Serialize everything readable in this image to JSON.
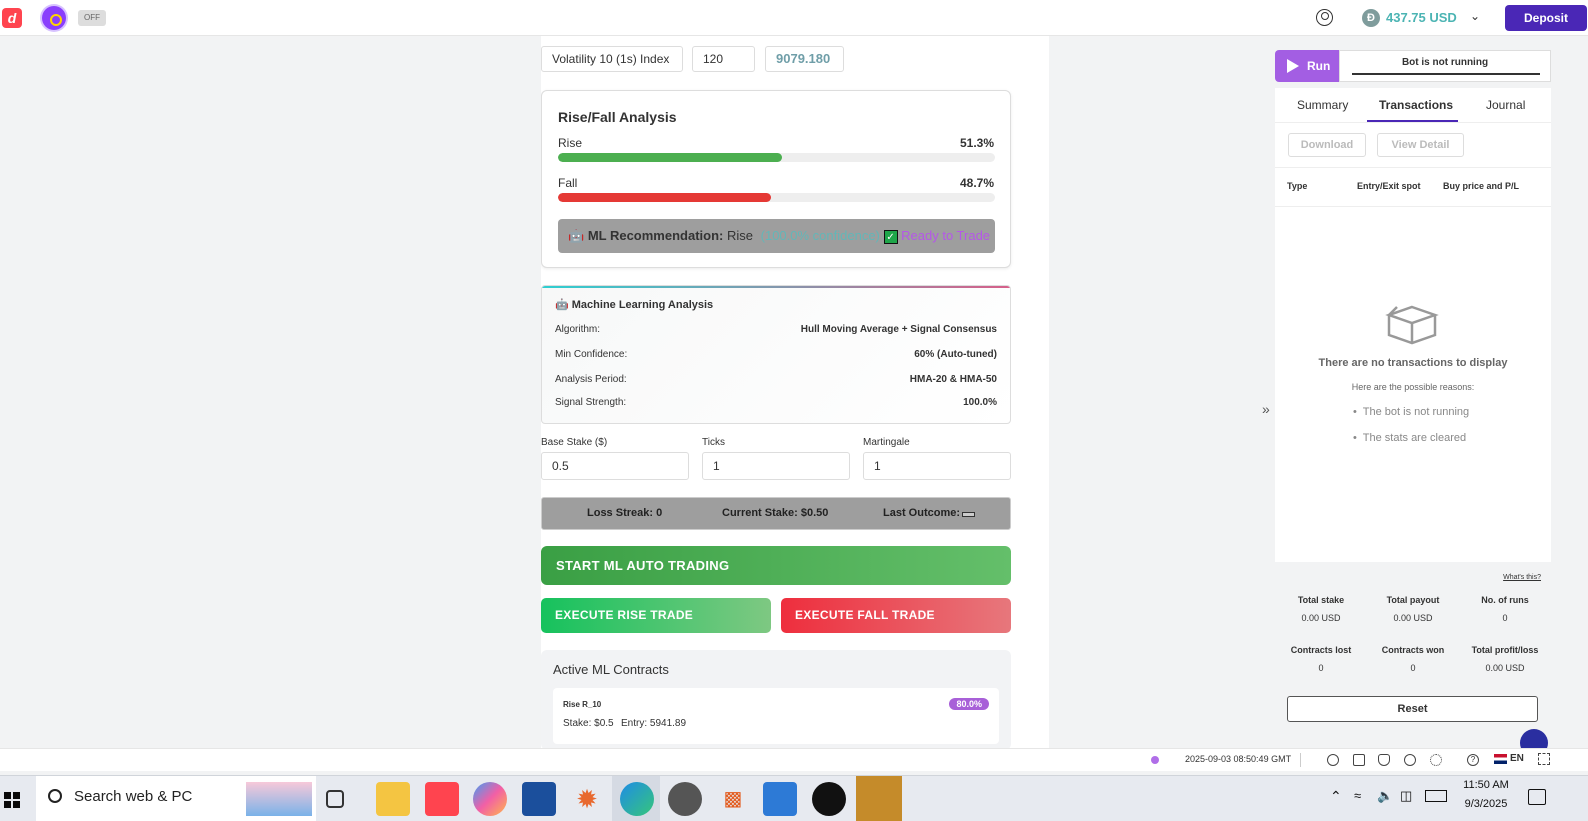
{
  "topbar": {
    "off_label": "OFF",
    "balance": "437.75 USD",
    "coin_symbol": "Đ",
    "deposit_label": "Deposit"
  },
  "selectors": {
    "market": "Volatility 10 (1s) Index",
    "ticks": "120",
    "price": "9079.180"
  },
  "rise_fall": {
    "title": "Rise/Fall Analysis",
    "rise_label": "Rise",
    "rise_pct": "51.3%",
    "rise_value": 51.3,
    "fall_label": "Fall",
    "fall_pct": "48.7%",
    "fall_value": 48.7,
    "rec_label": "ML Recommendation:",
    "rec_value": "Rise",
    "rec_confidence": "(100.0% confidence)",
    "rec_status": "Ready to Trade"
  },
  "ml_analysis": {
    "title": "Machine Learning Analysis",
    "rows": [
      {
        "key": "Algorithm:",
        "value": "Hull Moving Average + Signal Consensus"
      },
      {
        "key": "Min Confidence:",
        "value": "60% (Auto-tuned)"
      },
      {
        "key": "Analysis Period:",
        "value": "HMA-20 & HMA-50"
      },
      {
        "key": "Signal Strength:",
        "value": "100.0%"
      }
    ]
  },
  "fields": {
    "base_stake_label": "Base Stake ($)",
    "base_stake_value": "0.5",
    "ticks_label": "Ticks",
    "ticks_value": "1",
    "martingale_label": "Martingale",
    "martingale_value": "1"
  },
  "status_bar": {
    "loss_streak": "Loss Streak: 0",
    "current_stake": "Current Stake: $0.50",
    "last_outcome": "Last Outcome:"
  },
  "buttons": {
    "start": "START ML AUTO TRADING",
    "rise": "EXECUTE RISE TRADE",
    "fall": "EXECUTE FALL TRADE"
  },
  "active_contracts": {
    "title": "Active ML Contracts",
    "items": [
      {
        "name": "Rise R_10",
        "confidence": "80.0%",
        "stake": "Stake: $0.5",
        "entry": "Entry: 5941.89"
      }
    ]
  },
  "run_panel": {
    "run_label": "Run",
    "status": "Bot is not running",
    "tabs": [
      "Summary",
      "Transactions",
      "Journal"
    ],
    "active_tab": "Transactions",
    "download_label": "Download",
    "view_detail_label": "View Detail",
    "columns": [
      "Type",
      "Entry/Exit spot",
      "Buy price and P/L"
    ],
    "empty_title": "There are no transactions to display",
    "empty_sub": "Here are the possible reasons:",
    "reasons": [
      "The bot is not running",
      "The stats are cleared"
    ],
    "whats_this": "What's this?",
    "summary": [
      {
        "key": "Total stake",
        "value": "0.00 USD"
      },
      {
        "key": "Total payout",
        "value": "0.00 USD"
      },
      {
        "key": "No. of runs",
        "value": "0"
      },
      {
        "key": "Contracts lost",
        "value": "0"
      },
      {
        "key": "Contracts won",
        "value": "0"
      },
      {
        "key": "Total profit/loss",
        "value": "0.00 USD"
      }
    ],
    "reset_label": "Reset"
  },
  "footer": {
    "timestamp": "2025-09-03 08:50:49 GMT",
    "language": "EN"
  },
  "taskbar": {
    "search_placeholder": "Search web & PC",
    "time": "11:50 AM",
    "date": "9/3/2025"
  },
  "colors": {
    "accent_purple": "#a35ee3",
    "deposit": "#4a27b6",
    "rise_green": "#4caf50",
    "fall_red": "#e53935",
    "balance_teal": "#4bb4b3"
  }
}
